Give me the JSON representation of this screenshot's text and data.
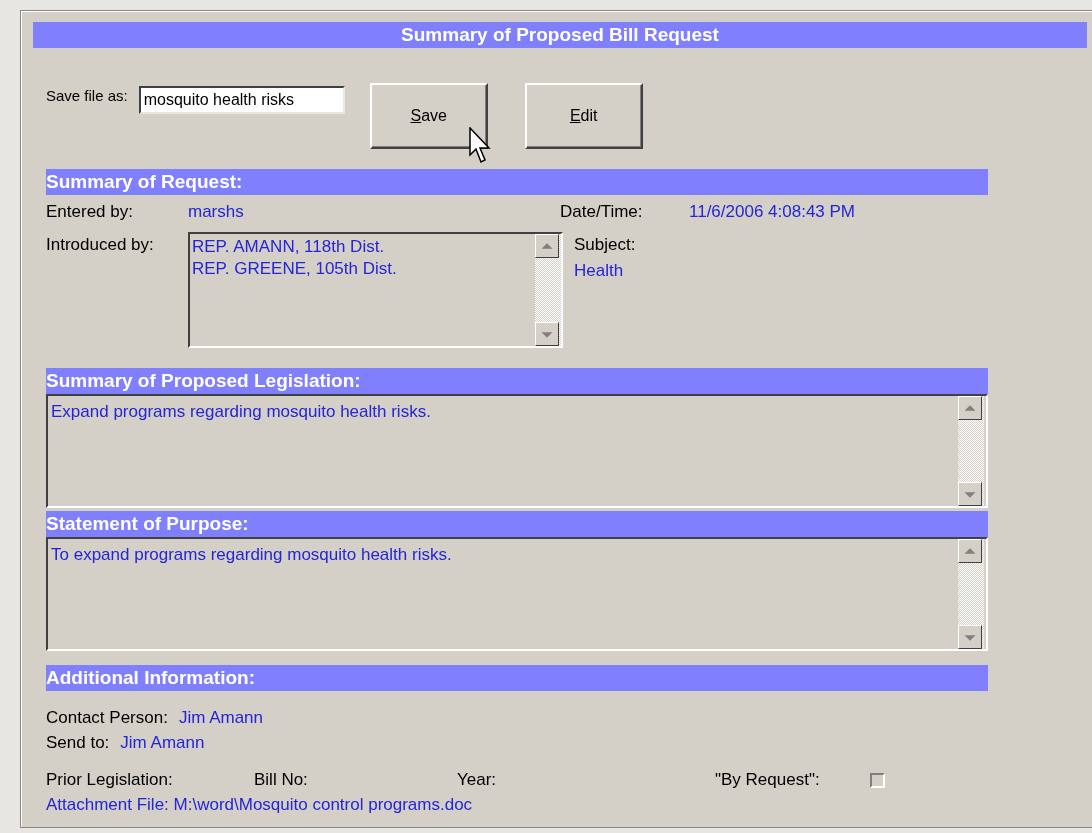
{
  "window": {
    "title": "Summary of Proposed Bill Request"
  },
  "save_file": {
    "label": "Save file as:",
    "value": "mosquito health risks"
  },
  "buttons": [
    {
      "label": "Save"
    },
    {
      "label": "Edit"
    }
  ],
  "summary_of_request": {
    "heading": "Summary of Request:",
    "entered_by": {
      "label": "Entered by:",
      "value": "marshs"
    },
    "date_time": {
      "label": "Date/Time:",
      "value": "11/6/2006 4:08:43 PM"
    },
    "introduced_by": {
      "label": "Introduced by:",
      "items": [
        "REP. AMANN, 118th Dist.",
        "REP. GREENE, 105th Dist."
      ]
    },
    "subject": {
      "label": "Subject:",
      "value": "Health"
    }
  },
  "proposed_legislation": {
    "heading": "Summary of Proposed Legislation:",
    "text": "Expand programs regarding mosquito health risks."
  },
  "statement_of_purpose": {
    "heading": "Statement of Purpose:",
    "text": "To expand programs regarding mosquito health risks."
  },
  "additional_information": {
    "heading": "Additional Information:",
    "contact_person": {
      "label": "Contact Person:",
      "value": "Jim Amann"
    },
    "send_to": {
      "label": "Send to:",
      "value": "Jim Amann"
    },
    "prior_legislation": {
      "label": "Prior Legislation:",
      "bill_no_label": "Bill No:",
      "year_label": "Year:"
    },
    "by_request": {
      "label": "\"By Request\":",
      "checked": false
    },
    "attachment": "Attachment File: M:\\word\\Mosquito control programs.doc"
  }
}
